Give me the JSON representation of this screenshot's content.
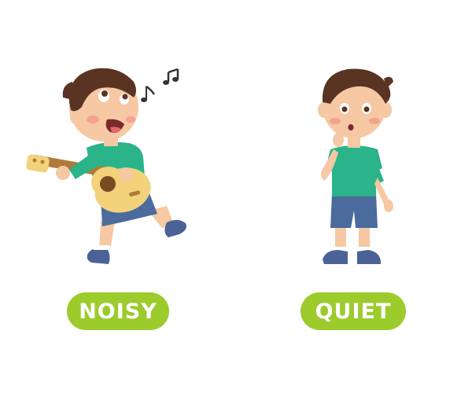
{
  "labels": {
    "left": "NOISY",
    "right": "QUIET"
  },
  "colors": {
    "pill": "#9ccb2c",
    "skin": "#f6c8a4",
    "hair": "#5a3422",
    "shirt": "#2bb38a",
    "shorts": "#4a6b9c",
    "guitar_body": "#f2d27a",
    "guitar_neck": "#b07a3a",
    "shoe": "#4a6296",
    "cheek": "#f39a8a"
  },
  "icons": {
    "music_notes": "music-notes-icon"
  }
}
